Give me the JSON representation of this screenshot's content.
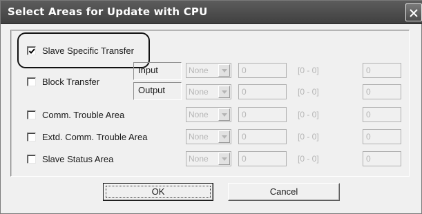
{
  "dialog": {
    "title": "Select Areas for Update with CPU"
  },
  "areas": {
    "slave_specific_transfer": {
      "label": "Slave Specific Transfer",
      "checked": true
    },
    "block_transfer": {
      "label": "Block Transfer",
      "checked": false,
      "input": {
        "label": "Input",
        "combo": "None",
        "value": "0",
        "range": "[0 - 0]",
        "extra": "0"
      },
      "output": {
        "label": "Output",
        "combo": "None",
        "value": "0",
        "range": "[0 - 0]",
        "extra": "0"
      }
    },
    "comm_trouble_area": {
      "label": "Comm. Trouble Area",
      "checked": false,
      "combo": "None",
      "value": "0",
      "range": "[0 - 0]",
      "extra": "0"
    },
    "extd_comm_trouble_area": {
      "label": "Extd. Comm. Trouble Area",
      "checked": false,
      "combo": "None",
      "value": "0",
      "range": "[0 - 0]",
      "extra": "0"
    },
    "slave_status_area": {
      "label": "Slave Status Area",
      "checked": false,
      "combo": "None",
      "value": "0",
      "range": "[0 - 0]",
      "extra": "0"
    }
  },
  "buttons": {
    "ok": "OK",
    "cancel": "Cancel"
  },
  "colors": {
    "titlebar": "#4a4a4a",
    "dialog_bg": "#f0f0f0",
    "disabled_text": "#b5b5b5"
  }
}
